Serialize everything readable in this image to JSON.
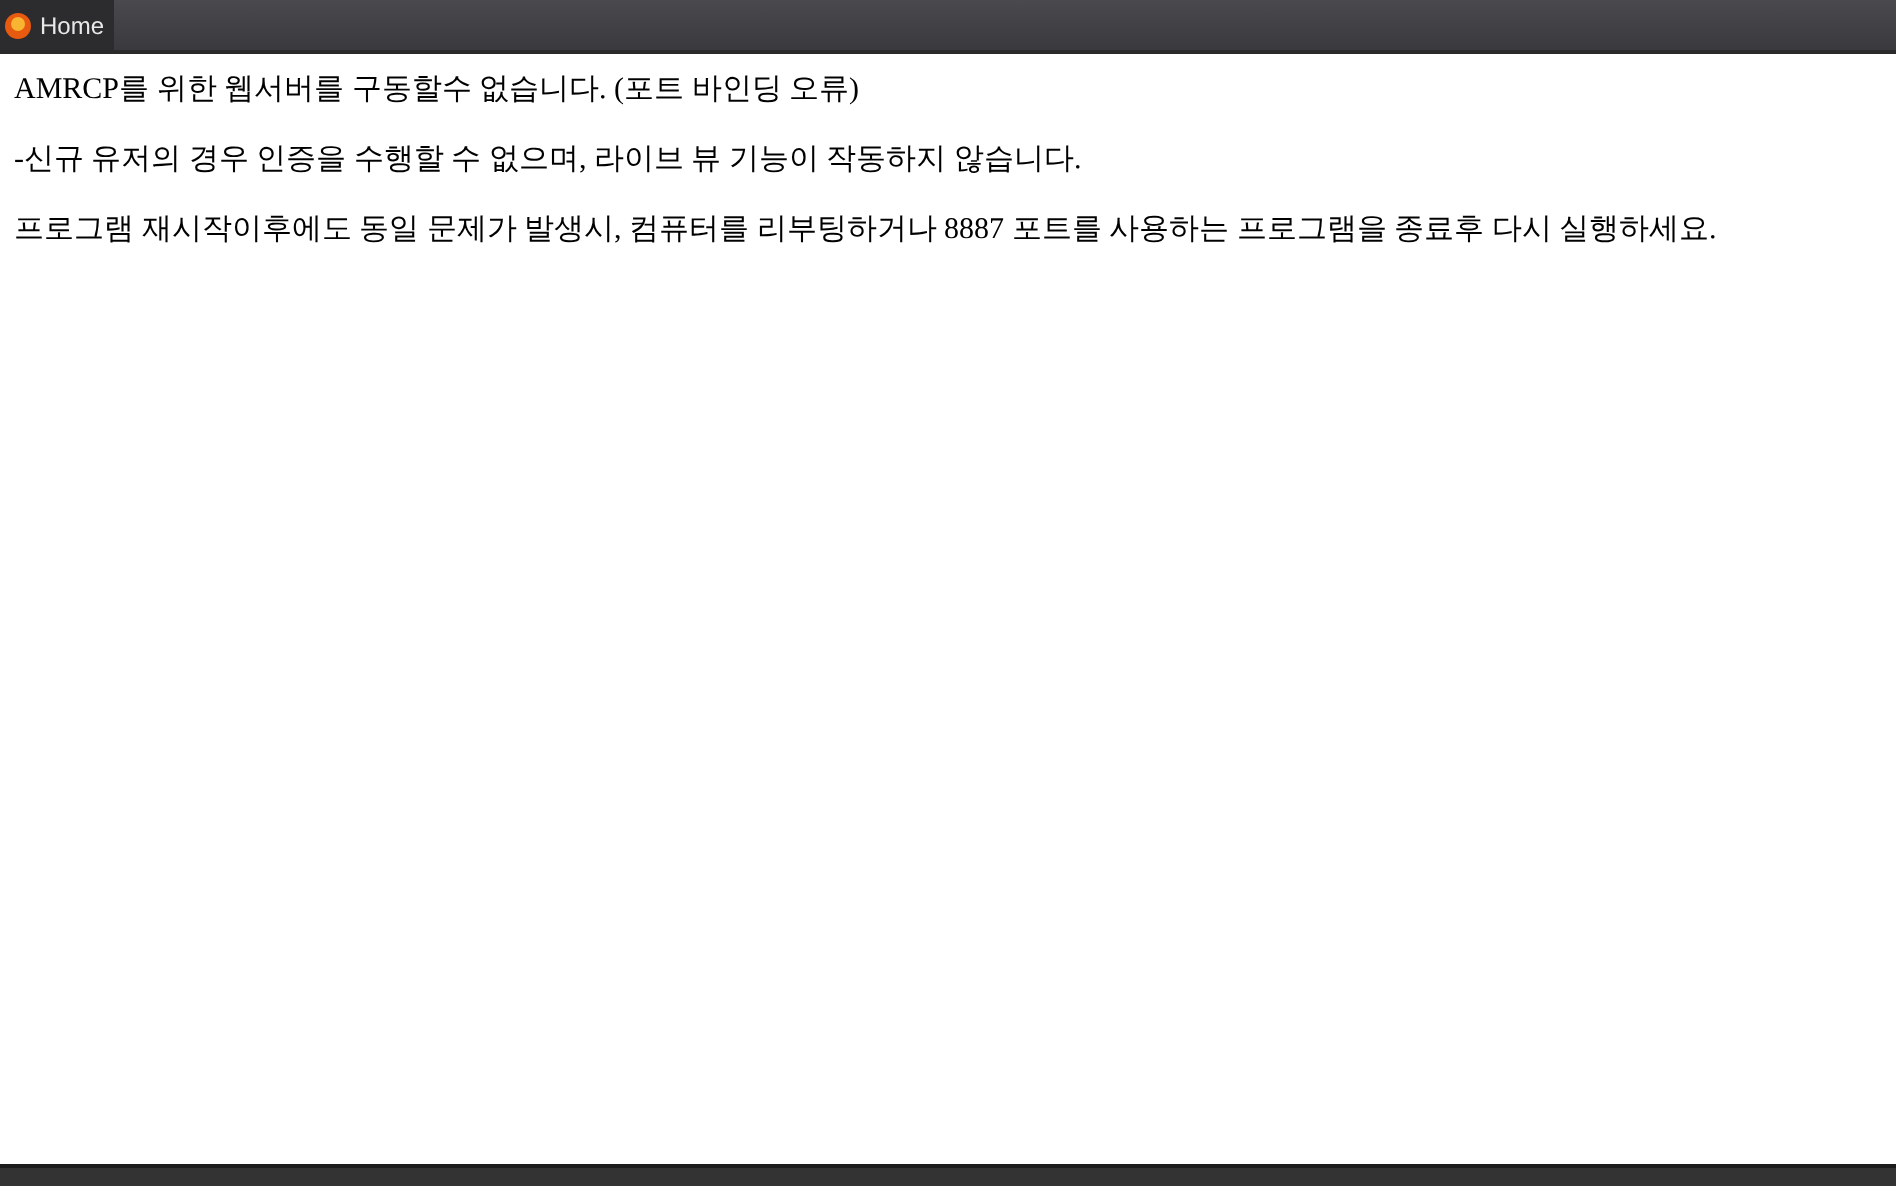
{
  "tabs": [
    {
      "label": "Home",
      "selected": true
    }
  ],
  "messages": [
    "AMRCP를 위한 웹서버를 구동할수 없습니다. (포트 바인딩 오류)",
    "-신규 유저의 경우 인증을 수행할 수 없으며, 라이브 뷰 기능이 작동하지 않습니다.",
    "프로그램 재시작이후에도 동일 문제가 발생시, 컴퓨터를 리부팅하거나 8887 포트를 사용하는 프로그램을 종료후 다시 실행하세요."
  ]
}
